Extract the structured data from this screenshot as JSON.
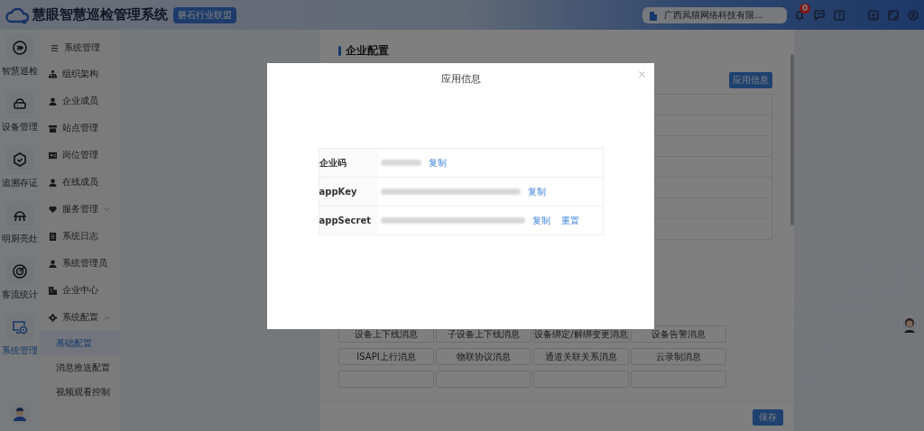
{
  "header": {
    "title": "慧眼智慧巡检管理系统",
    "badge": "磐石行业联盟",
    "company": "广西凤猫网络科技有限...",
    "notifications": "0"
  },
  "rail": [
    {
      "label": "智慧巡检",
      "selected": false
    },
    {
      "label": "设备管理",
      "selected": false
    },
    {
      "label": "追溯存证",
      "selected": false
    },
    {
      "label": "明厨亮灶",
      "selected": false
    },
    {
      "label": "客流统计",
      "selected": false
    },
    {
      "label": "系统管理",
      "selected": true
    }
  ],
  "menu": {
    "title": "系统管理",
    "items": [
      {
        "label": "组织架构",
        "selected": false
      },
      {
        "label": "企业成员",
        "selected": false
      },
      {
        "label": "站点管理",
        "selected": false
      },
      {
        "label": "岗位管理",
        "selected": false
      },
      {
        "label": "在线成员",
        "selected": false
      },
      {
        "label": "服务管理",
        "selected": false,
        "expanded": false
      },
      {
        "label": "系统日志",
        "selected": false
      },
      {
        "label": "系统管理员",
        "selected": false
      },
      {
        "label": "企业中心",
        "selected": false
      },
      {
        "label": "系统配置",
        "selected": false,
        "expanded": true,
        "children": [
          {
            "label": "基础配置",
            "selected": true
          },
          {
            "label": "消息推送配置",
            "selected": false
          },
          {
            "label": "视频观看控制",
            "selected": false
          }
        ]
      }
    ]
  },
  "page": {
    "title": "企业配置",
    "app_info_button": "应用信息",
    "message_types": [
      [
        "设备上下线消息",
        "子设备上下线消息",
        "设备绑定/解绑变更消息",
        "设备告警消息"
      ],
      [
        "ISAPI上行消息",
        "物联协议消息",
        "通道关联关系消息",
        "云录制消息"
      ]
    ],
    "save_button": "保存"
  },
  "dialog": {
    "title": "应用信息",
    "rows": [
      {
        "label": "企业码",
        "actions": [
          "复制"
        ]
      },
      {
        "label": "appKey",
        "actions": [
          "复制"
        ]
      },
      {
        "label": "appSecret",
        "actions": [
          "复制",
          "重置"
        ]
      }
    ]
  }
}
